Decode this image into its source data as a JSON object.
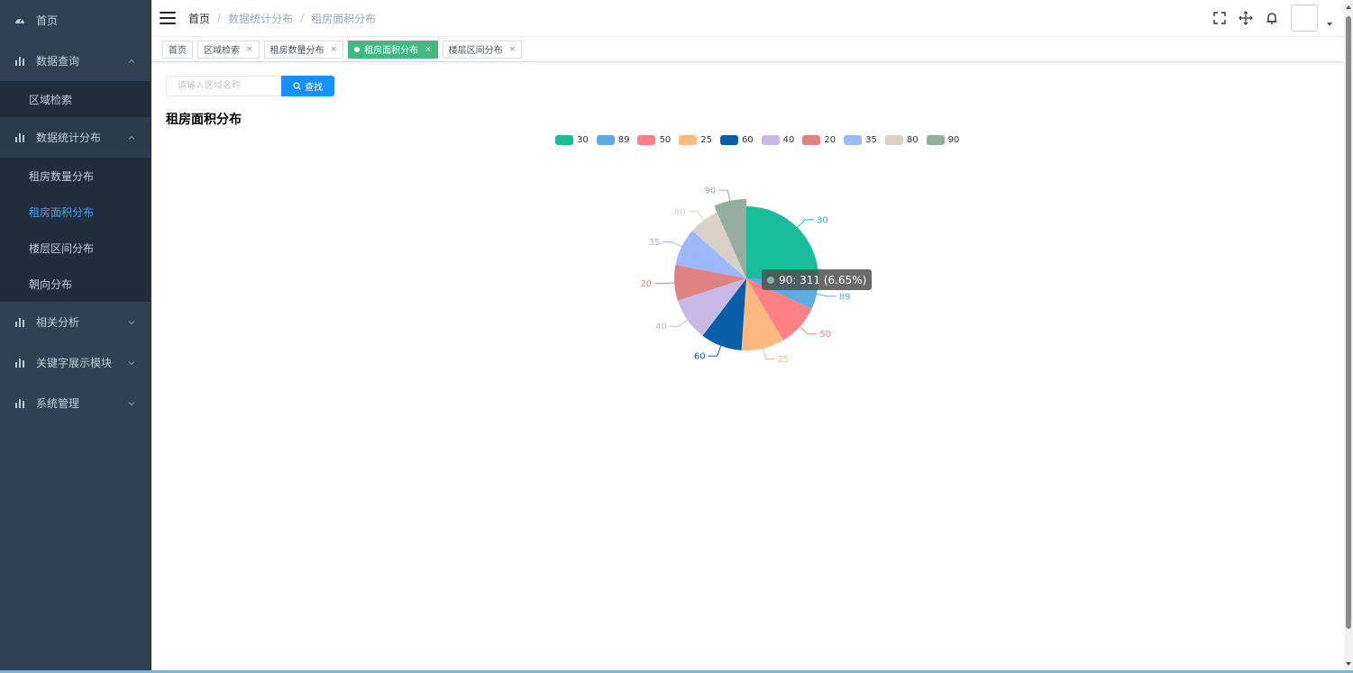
{
  "sidebar": {
    "items": [
      {
        "label": "首页",
        "icon": "dashboard-icon"
      },
      {
        "label": "数据查询",
        "icon": "bar-chart-icon",
        "expanded": true,
        "children": [
          "区域检索"
        ]
      },
      {
        "label": "数据统计分布",
        "icon": "bar-chart-icon",
        "expanded": true,
        "children": [
          "租房数量分布",
          "租房面积分布",
          "楼层区间分布",
          "朝向分布"
        ]
      },
      {
        "label": "相关分析",
        "icon": "bar-chart-icon"
      },
      {
        "label": "关键字展示模块",
        "icon": "bar-chart-icon"
      },
      {
        "label": "系统管理",
        "icon": "bar-chart-icon"
      }
    ],
    "active_child": "租房面积分布",
    "active_color": "#409eff"
  },
  "navbar": {
    "breadcrumb": [
      "首页",
      "数据统计分布",
      "租房面积分布"
    ],
    "icons": [
      "fullscreen-icon",
      "size-move-icon",
      "bell-icon"
    ]
  },
  "tags": [
    {
      "label": "首页",
      "closable": false,
      "active": false
    },
    {
      "label": "区域检索",
      "closable": true,
      "active": false
    },
    {
      "label": "租房数量分布",
      "closable": true,
      "active": false
    },
    {
      "label": "租房面积分布",
      "closable": true,
      "active": true
    },
    {
      "label": "楼层区间分布",
      "closable": true,
      "active": false
    }
  ],
  "tag_close_glyph": "×",
  "search": {
    "placeholder": "请输入区域名称",
    "button_label": "查找"
  },
  "page_title": "租房面积分布",
  "chart_data": {
    "type": "pie",
    "title": "租房面积分布",
    "legend_position": "top-center",
    "slices": [
      {
        "name": "30",
        "value": 1168,
        "color": "#1abc9c"
      },
      {
        "name": "89",
        "value": 327,
        "color": "#5dade2"
      },
      {
        "name": "50",
        "value": 443,
        "color": "#ff7f86"
      },
      {
        "name": "25",
        "value": 451,
        "color": "#ffb980"
      },
      {
        "name": "60",
        "value": 435,
        "color": "#0b5ea8"
      },
      {
        "name": "40",
        "value": 451,
        "color": "#c8b8e6"
      },
      {
        "name": "20",
        "value": 374,
        "color": "#e08283"
      },
      {
        "name": "35",
        "value": 397,
        "color": "#9db8ff"
      },
      {
        "name": "80",
        "value": 320,
        "color": "#d9d0c7"
      },
      {
        "name": "90",
        "value": 311,
        "color": "#93ad9f"
      }
    ],
    "highlighted": "90",
    "tooltip": "90: 311 (6.65%)"
  }
}
